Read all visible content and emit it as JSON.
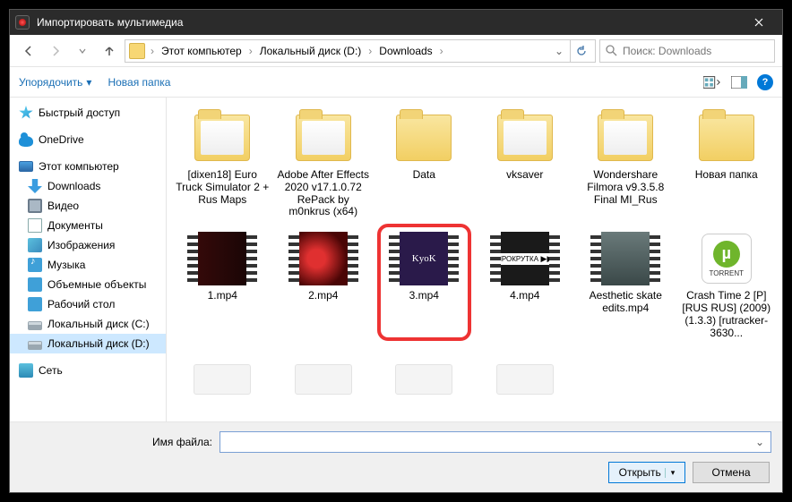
{
  "titlebar": {
    "title": "Импортировать мультимедиа"
  },
  "breadcrumb": {
    "root": "Этот компьютер",
    "disk": "Локальный диск (D:)",
    "folder": "Downloads"
  },
  "search": {
    "placeholder": "Поиск: Downloads"
  },
  "toolbar": {
    "organize": "Упорядочить",
    "newfolder": "Новая папка"
  },
  "sidebar": {
    "quick": "Быстрый доступ",
    "onedrive": "OneDrive",
    "pc": "Этот компьютер",
    "downloads": "Downloads",
    "video": "Видео",
    "documents": "Документы",
    "images": "Изображения",
    "music": "Музыка",
    "objects": "Объемные объекты",
    "desktop": "Рабочий стол",
    "diskc": "Локальный диск (C:)",
    "diskd": "Локальный диск (D:)",
    "network": "Сеть"
  },
  "files": {
    "f0": "[dixen18] Euro Truck Simulator 2 + Rus Maps",
    "f1": "Adobe After Effects 2020 v17.1.0.72 RePack by m0nkrus (x64)",
    "f2": "Data",
    "f3": "vksaver",
    "f4": "Wondershare Filmora v9.3.5.8 Final MI_Rus",
    "f5": "Новая папка",
    "v1": "1.mp4",
    "v2": "2.mp4",
    "v3": "3.mp4",
    "v4": "4.mp4",
    "v5": "Aesthetic skate edits.mp4",
    "t1": "Crash Time 2 [P] [RUS RUS] (2009) (1.3.3) [rutracker-3630...",
    "kyok": "KyoK",
    "ff": "ПРОКРУТКА"
  },
  "footer": {
    "filename_label": "Имя файла:",
    "filename_value": "",
    "open": "Открыть",
    "cancel": "Отмена"
  }
}
